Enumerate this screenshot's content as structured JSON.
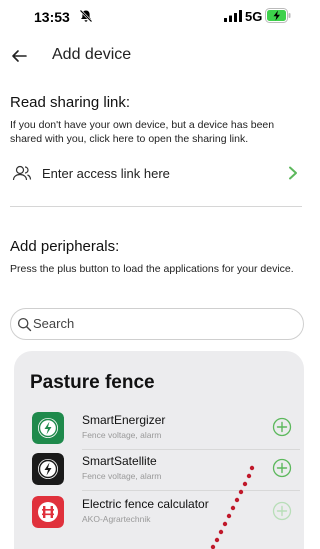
{
  "status_bar": {
    "time": "13:53",
    "network": "5G"
  },
  "header": {
    "title": "Add device"
  },
  "sharing": {
    "title": "Read sharing link:",
    "description": "If you don't have your own device, but a device has been shared with you, click here to open the sharing link.",
    "access_label": "Enter access link here"
  },
  "peripherals": {
    "title": "Add peripherals:",
    "description": "Press the plus button to load the applications for your device."
  },
  "search": {
    "placeholder": "Search"
  },
  "card": {
    "title": "Pasture fence",
    "apps": [
      {
        "name": "SmartEnergizer",
        "subtitle": "Fence voltage, alarm"
      },
      {
        "name": "SmartSatellite",
        "subtitle": "Fence voltage, alarm"
      },
      {
        "name": "Electric fence calculator",
        "subtitle": "AKO-Agrartechnik"
      }
    ]
  },
  "colors": {
    "accent_green": "#5cb85c",
    "icon_green": "#1f8a4c",
    "icon_dark": "#1a1a1a",
    "icon_red": "#e0313c",
    "dot_red": "#c0182a"
  }
}
